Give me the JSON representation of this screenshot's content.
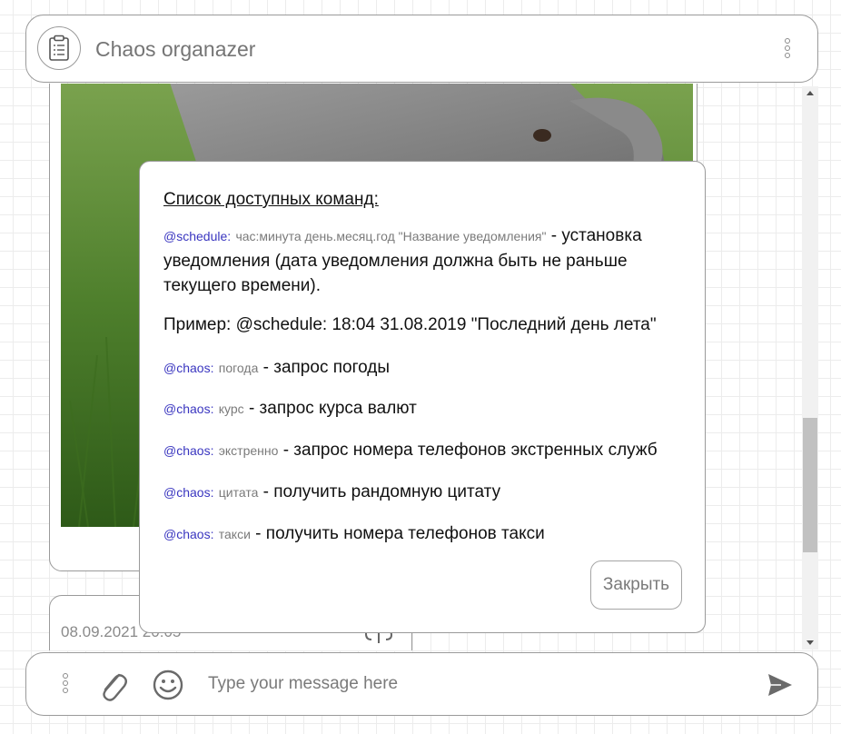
{
  "header": {
    "title": "Chaos organazer",
    "logo_icon": "clipboard-icon",
    "menu_icon": "kebab-menu-icon"
  },
  "feed": {
    "message_time": "08.09.2021 20:05",
    "photo_alt": "elephant-photo"
  },
  "modal": {
    "title": "Список доступных команд:",
    "schedule": {
      "keyword": "@schedule:",
      "args": "час:минута день.месяц.год \"Название уведомления\"",
      "desc": " - установка уведомления (дата уведомления должна быть не раньше текущего времени)."
    },
    "example": "Пример: @schedule: 18:04 31.08.2019 \"Последний день лета\"",
    "commands": [
      {
        "keyword": "@chaos:",
        "arg": "погода",
        "desc": " - запрос погоды"
      },
      {
        "keyword": "@chaos:",
        "arg": "курс",
        "desc": " - запрос курса валют"
      },
      {
        "keyword": "@chaos:",
        "arg": "экстренно",
        "desc": " - запрос номера телефонов экстренных служб"
      },
      {
        "keyword": "@chaos:",
        "arg": "цитата",
        "desc": " - получить рандомную цитату"
      },
      {
        "keyword": "@chaos:",
        "arg": "такси",
        "desc": " - получить номера телефонов такси"
      }
    ],
    "close_label": "Закрыть"
  },
  "composer": {
    "placeholder": "Type your message here"
  }
}
